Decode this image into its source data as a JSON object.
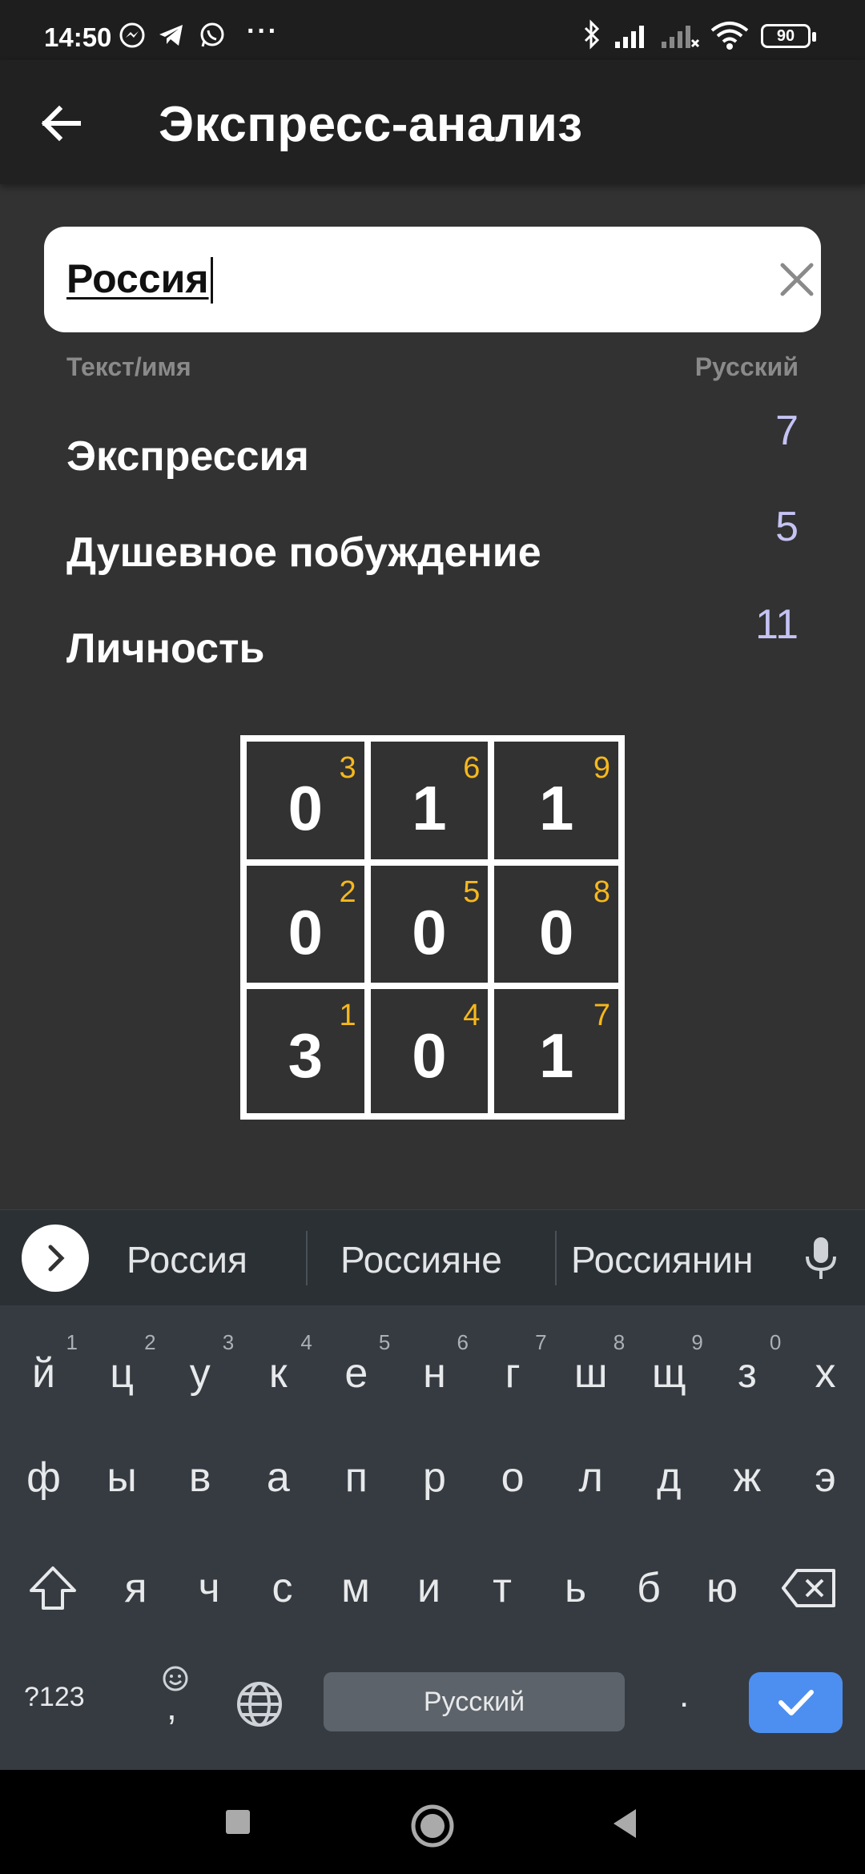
{
  "status_bar": {
    "time": "14:50",
    "battery": "90",
    "icons": [
      "messenger-icon",
      "telegram-icon",
      "whatsapp-icon",
      "more-dots-icon",
      "bluetooth-icon",
      "signal-icon",
      "signal-off-icon",
      "wifi-icon",
      "battery-icon"
    ]
  },
  "app_bar": {
    "title": "Экспресс-анализ",
    "back_icon": "arrow-left-icon"
  },
  "search": {
    "value": "Россия",
    "clear_icon": "close-icon"
  },
  "columns": {
    "left": "Текст/имя",
    "right": "Русский"
  },
  "results": [
    {
      "label": "Экспрессия",
      "value": "7"
    },
    {
      "label": "Душевное побуждение",
      "value": "5"
    },
    {
      "label": "Личность",
      "value": "11"
    }
  ],
  "grid": [
    {
      "digit": "0",
      "index": "3"
    },
    {
      "digit": "1",
      "index": "6"
    },
    {
      "digit": "1",
      "index": "9"
    },
    {
      "digit": "0",
      "index": "2"
    },
    {
      "digit": "0",
      "index": "5"
    },
    {
      "digit": "0",
      "index": "8"
    },
    {
      "digit": "3",
      "index": "1"
    },
    {
      "digit": "0",
      "index": "4"
    },
    {
      "digit": "1",
      "index": "7"
    }
  ],
  "keyboard": {
    "suggestions": [
      "Россия",
      "Россияне",
      "Россиянин"
    ],
    "row1": [
      {
        "key": "й",
        "hint": "1"
      },
      {
        "key": "ц",
        "hint": "2"
      },
      {
        "key": "у",
        "hint": "3"
      },
      {
        "key": "к",
        "hint": "4"
      },
      {
        "key": "е",
        "hint": "5"
      },
      {
        "key": "н",
        "hint": "6"
      },
      {
        "key": "г",
        "hint": "7"
      },
      {
        "key": "ш",
        "hint": "8"
      },
      {
        "key": "щ",
        "hint": "9"
      },
      {
        "key": "з",
        "hint": "0"
      },
      {
        "key": "х",
        "hint": ""
      }
    ],
    "row2": [
      "ф",
      "ы",
      "в",
      "а",
      "п",
      "р",
      "о",
      "л",
      "д",
      "ж",
      "э"
    ],
    "row3": [
      "я",
      "ч",
      "с",
      "м",
      "и",
      "т",
      "ь",
      "б",
      "ю"
    ],
    "sym_label": "?123",
    "emoji_comma": ",",
    "space_label": "Русский",
    "dot_label": "."
  },
  "accent_colors": {
    "cell_index": "#f6b81c",
    "result_value": "#c5c3f4",
    "enter_key": "#4d8ff0"
  }
}
